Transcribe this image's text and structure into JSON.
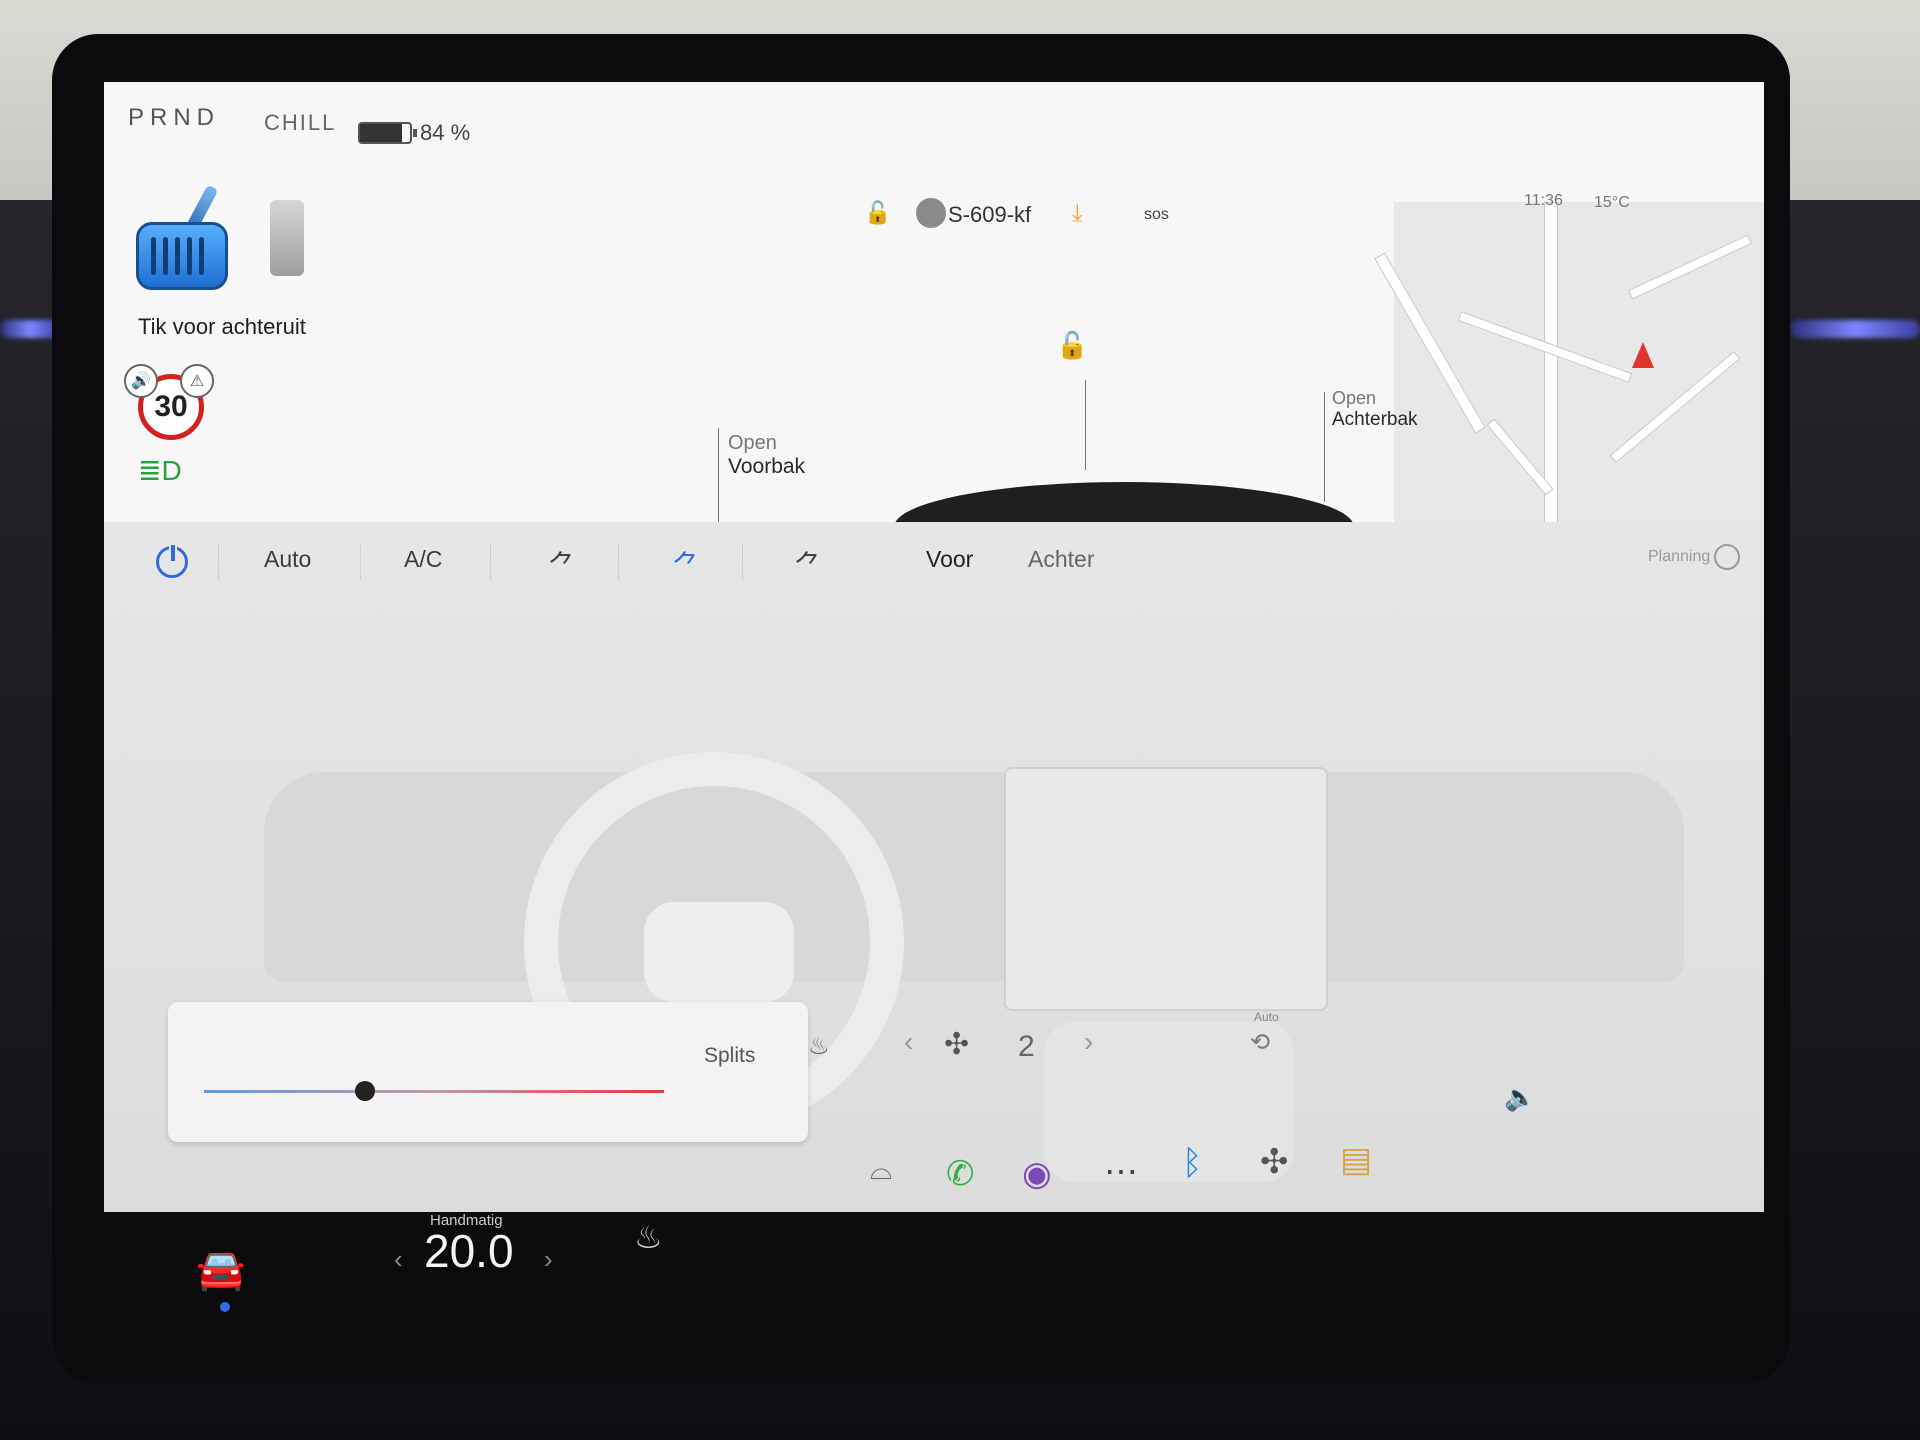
{
  "status": {
    "gear": "PRND",
    "mode": "CHILL",
    "battery_percent": 84,
    "battery_label": "84 %",
    "profile": "S-609-kf",
    "sos_label": "sos",
    "time": "11:36",
    "temperature": "15°C"
  },
  "drive": {
    "hint": "Tik voor achteruit",
    "speed_limit": "30"
  },
  "car": {
    "frunk_state": "Open",
    "frunk_label": "Voorbak",
    "trunk_state": "Open",
    "trunk_label": "Achterbak"
  },
  "climate": {
    "auto_label": "Auto",
    "ac_label": "A/C",
    "front_label": "Voor",
    "rear_label": "Achter",
    "planning_label": "Planning",
    "split_label": "Splits",
    "fan_speed": "2",
    "recirc_auto_label": "Auto",
    "slider_level": 0.35
  },
  "bottom": {
    "mode_label": "Handmatig",
    "cabin_temp": "20.0"
  },
  "icons": {
    "accent": "#2f6be0",
    "speed_ring": "#d52020",
    "phone": "#2fb14a",
    "download": "#f0a230",
    "bluetooth": "#1e88e5"
  }
}
